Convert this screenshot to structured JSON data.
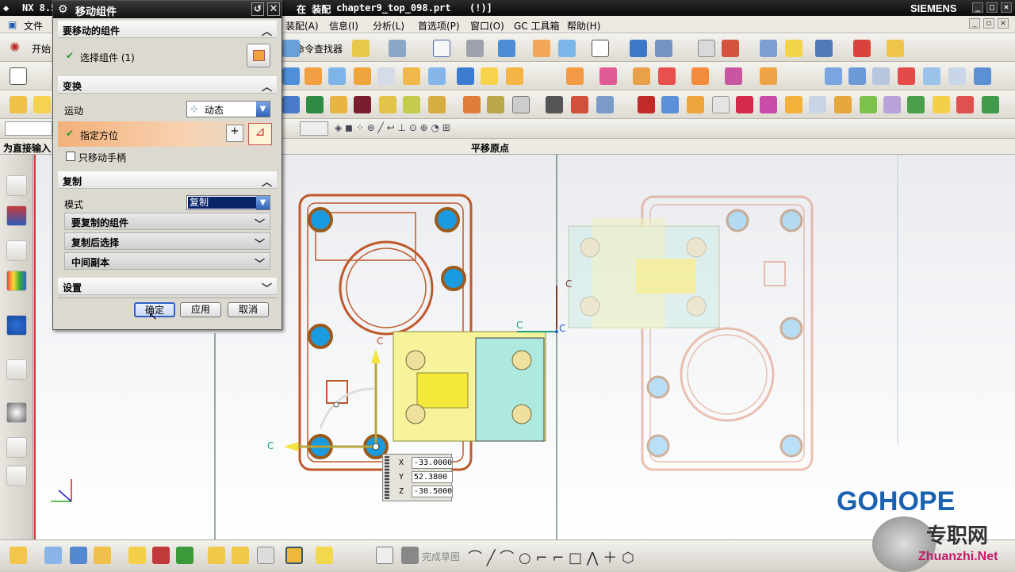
{
  "app": {
    "title_prefix": "NX 8.5",
    "title_context": "在 装配",
    "file_name": "chapter9_top_098.prt",
    "title_suffix": "(!)]",
    "brand": "SIEMENS"
  },
  "menu": [
    "文件(F)",
    "装配(A)",
    "信息(I)",
    "分析(L)",
    "首选项(P)",
    "窗口(O)",
    "GC 工具箱",
    "帮助(H)"
  ],
  "menu_labels": {
    "file": "文件",
    "start": "开始",
    "assembly": "装配(A)",
    "info": "信息(I)",
    "analysis": "分析(L)",
    "prefs": "首选项(P)",
    "window": "窗口(O)",
    "gc": "GC 工具箱",
    "help": "帮助(H)",
    "cmd_finder": "命令查找器"
  },
  "status": {
    "left": "为直接输入",
    "center": "平移原点"
  },
  "dialog": {
    "title": "移动组件",
    "sections": {
      "components": "要移动的组件",
      "select_component": "选择组件 (1)",
      "transform": "变换",
      "motion_label": "运动",
      "motion_value": "动态",
      "specify_orientation": "指定方位",
      "only_move_handle": "只移动手柄",
      "copy": "复制",
      "mode_label": "模式",
      "mode_value": "复制",
      "copy_components": "要复制的组件",
      "select_after_copy": "复制后选择",
      "intermediate_copies": "中间副本",
      "settings": "设置"
    },
    "buttons": {
      "ok": "确定",
      "apply": "应用",
      "cancel": "取消"
    }
  },
  "coords": {
    "x_label": "X",
    "x": "-33.0000",
    "y_label": "Y",
    "y": "52.3800",
    "z_label": "Z",
    "z": "-30.5000"
  },
  "canvas_labels": {
    "c1": "C",
    "c2": "C",
    "c3": "C",
    "c4": "C",
    "c5": "C"
  },
  "bottom": {
    "finish_sketch": "完成草图"
  },
  "watermark": {
    "logo": "GOHOPE",
    "site": "Zhuanzhi.Net",
    "cn": "专职网"
  },
  "colors": {
    "accent_orange": "#f0a060",
    "part_outline": "#c0582a",
    "hole_blue": "#1a9be0",
    "slider_yellow": "#f4f08a",
    "slider_cyan": "#aee9df"
  }
}
